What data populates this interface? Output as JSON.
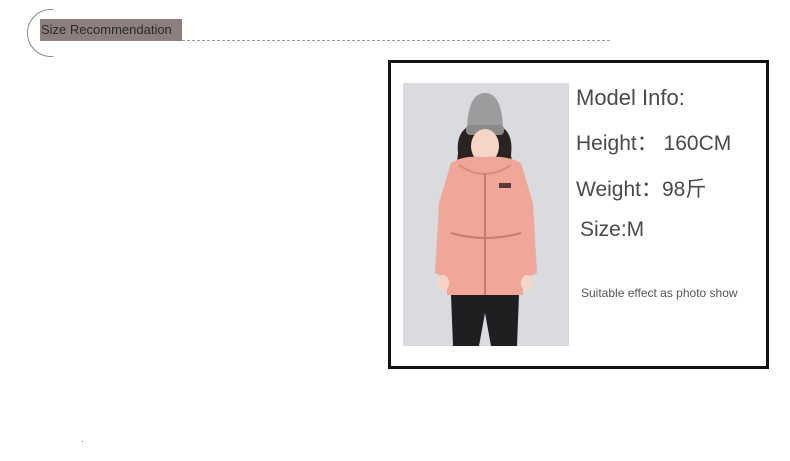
{
  "header": {
    "tag_label": "Size Recommendation"
  },
  "model_info": {
    "title": "Model Info:",
    "height": "Height： 160CM",
    "weight": "Weight：98斤",
    "size": "Size:M",
    "note": "Suitable effect as photo show"
  },
  "colors": {
    "tag_background": "#8d7f7f",
    "card_border": "#111111",
    "jacket": "#f0a79a",
    "photo_background": "#d8dadd"
  },
  "icons": {
    "header_decoration": "half-circle-outline"
  }
}
